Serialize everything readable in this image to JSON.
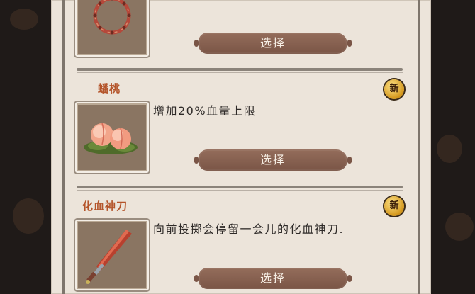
{
  "items": [
    {
      "title": "",
      "description": "",
      "select_label": "选择",
      "icon": "thorn-ring-icon",
      "is_new": false
    },
    {
      "title": "蟠桃",
      "description": "增加20%血量上限",
      "select_label": "选择",
      "icon": "peach-icon",
      "is_new": true,
      "badge_label": "新"
    },
    {
      "title": "化血神刀",
      "description": "向前投掷会停留一会儿的化血神刀.",
      "select_label": "选择",
      "icon": "blood-blade-icon",
      "is_new": true,
      "badge_label": "新"
    }
  ],
  "colors": {
    "panel": "#ece4da",
    "title": "#b4542a",
    "button": "#8a6150",
    "badge": "#d3961b"
  }
}
